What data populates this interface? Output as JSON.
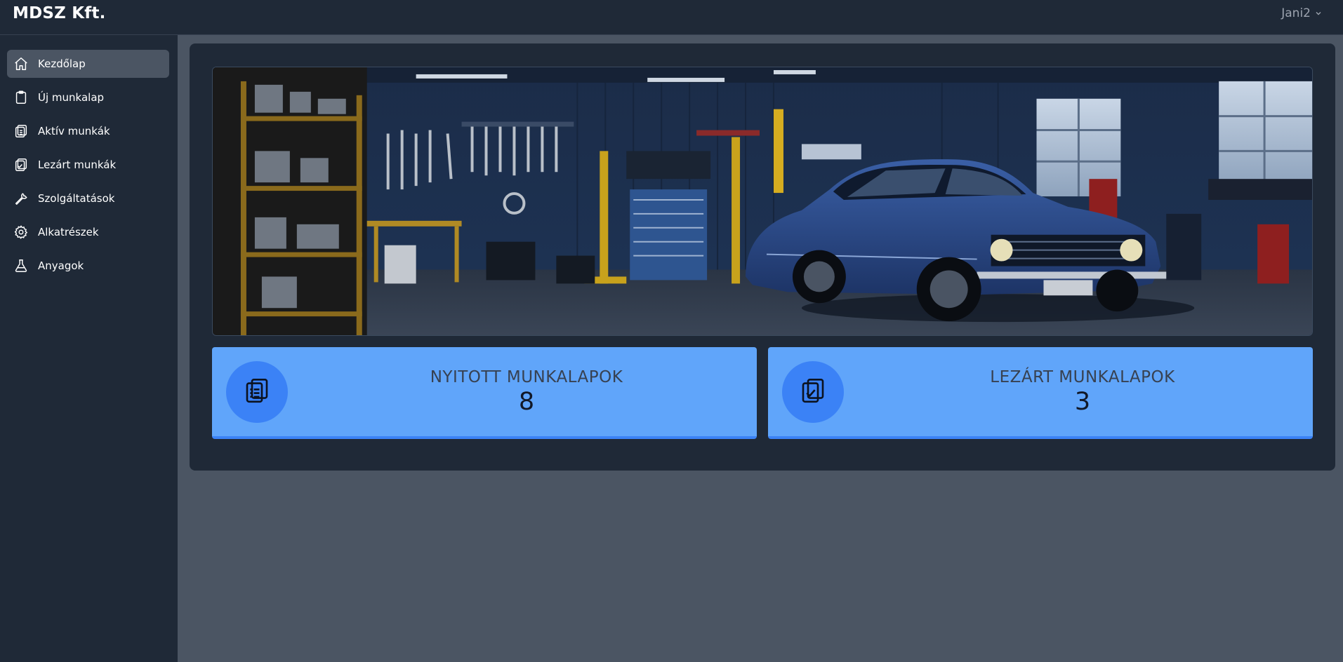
{
  "app": {
    "title": "MDSZ Kft."
  },
  "user": {
    "name": "Jani2"
  },
  "sidebar": {
    "items": [
      {
        "label": "Kezdőlap",
        "icon": "home-icon",
        "active": true
      },
      {
        "label": "Új munkalap",
        "icon": "clipboard-icon",
        "active": false
      },
      {
        "label": "Aktív munkák",
        "icon": "clipboard-list-icon",
        "active": false
      },
      {
        "label": "Lezárt munkák",
        "icon": "clipboard-check-icon",
        "active": false
      },
      {
        "label": "Szolgáltatások",
        "icon": "wrench-icon",
        "active": false
      },
      {
        "label": "Alkatrészek",
        "icon": "gear-icon",
        "active": false
      },
      {
        "label": "Anyagok",
        "icon": "flask-icon",
        "active": false
      }
    ]
  },
  "stats": [
    {
      "label": "NYITOTT MUNKALAPOK",
      "value": "8",
      "icon": "clipboard-list-icon"
    },
    {
      "label": "LEZÁRT MUNKALAPOK",
      "value": "3",
      "icon": "clipboard-check-icon"
    }
  ],
  "colors": {
    "sidebar_bg": "#1f2937",
    "content_bg": "#4b5563",
    "active_item": "#4b5563",
    "card_bg": "#60a5fa",
    "card_icon_bg": "#3b82f6"
  }
}
